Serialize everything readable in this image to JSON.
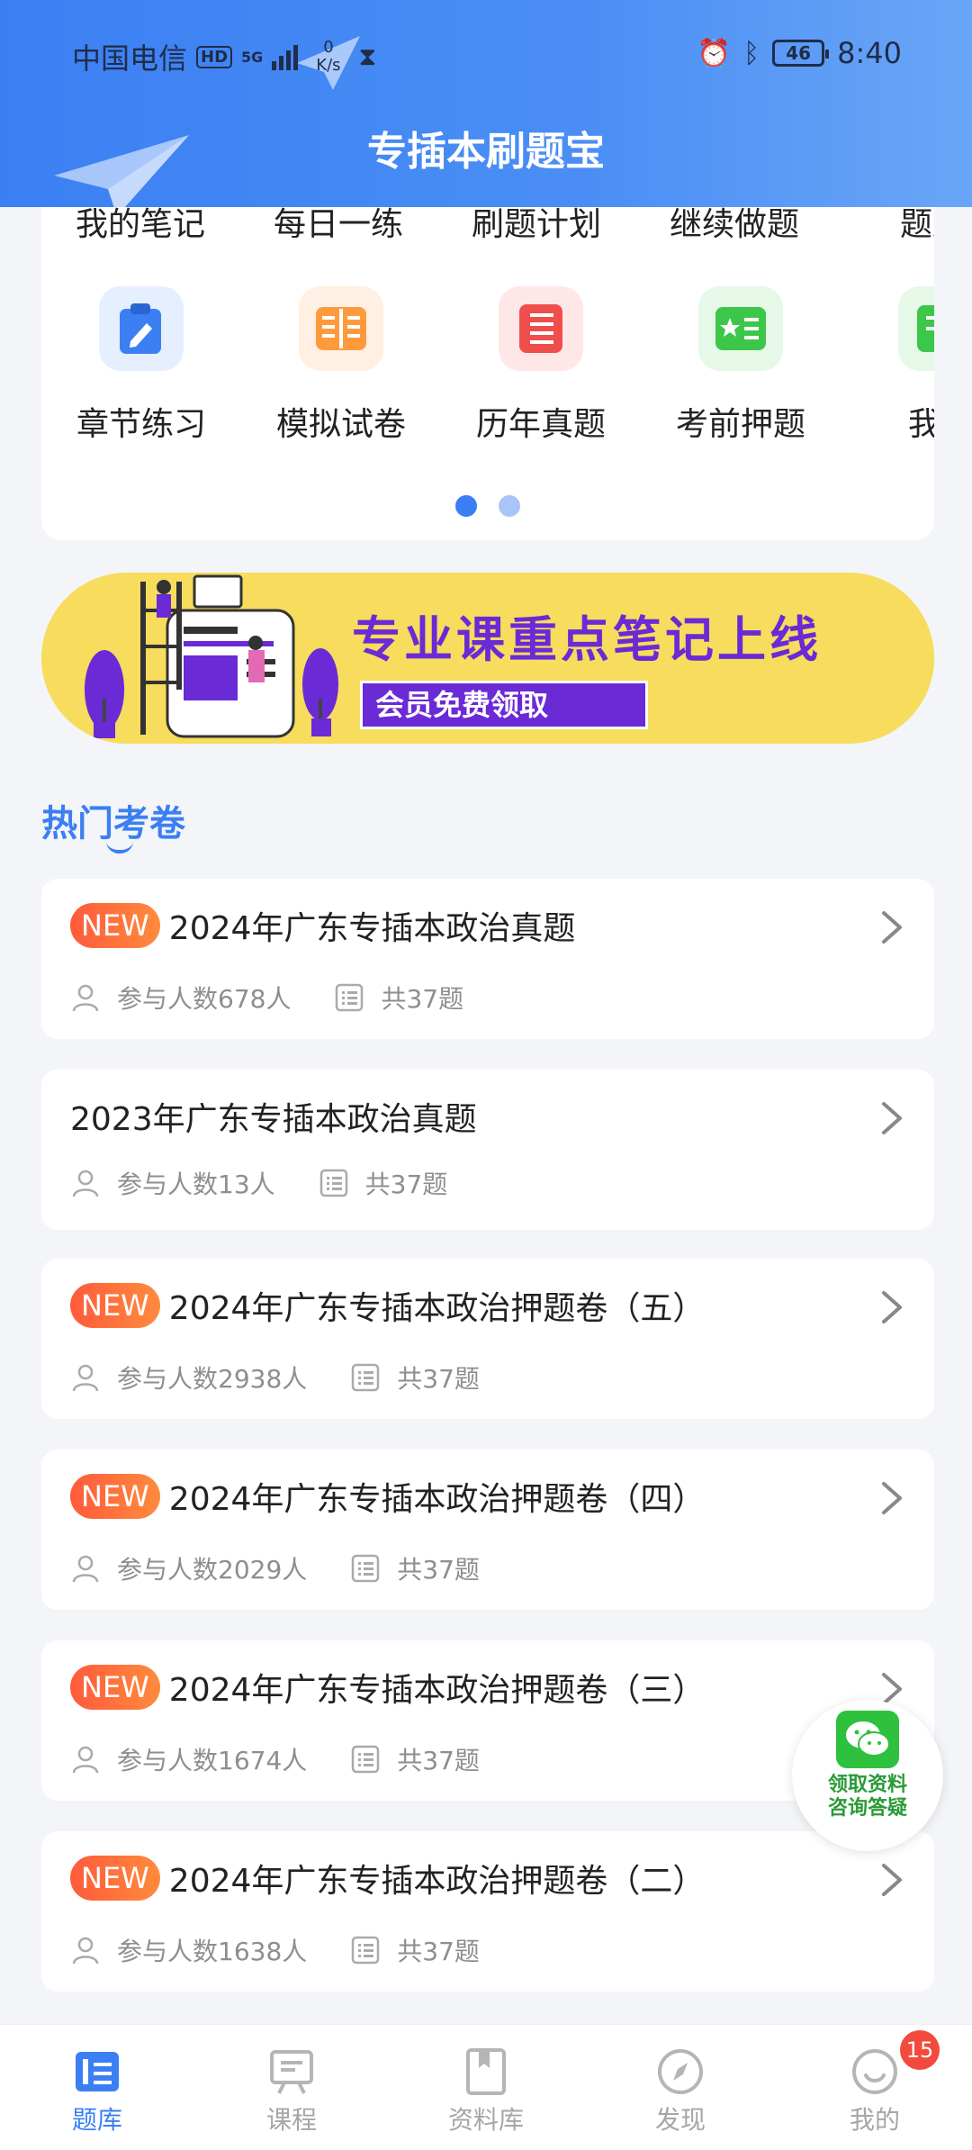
{
  "status_bar": {
    "carrier": "中国电信",
    "hd": "HD",
    "network": "5G",
    "speed_value": "0",
    "speed_unit": "K/s",
    "battery": "46",
    "time": "8:40"
  },
  "header": {
    "title": "专插本刷题宝"
  },
  "categories": {
    "cut_row": [
      "我的笔记",
      "每日一练",
      "刷题计划",
      "继续做题",
      "题型"
    ],
    "items": [
      {
        "label": "章节练习",
        "icon": "pencil-clipboard-icon",
        "color": "#3b7ff3",
        "bg": "#e6efff"
      },
      {
        "label": "模拟试卷",
        "icon": "open-book-icon",
        "color": "#ff9a3c",
        "bg": "#fff0e3"
      },
      {
        "label": "历年真题",
        "icon": "list-document-icon",
        "color": "#f04d4d",
        "bg": "#ffe7e7"
      },
      {
        "label": "考前押题",
        "icon": "star-book-icon",
        "color": "#3cc74a",
        "bg": "#e6f8e8"
      },
      {
        "label": "我的",
        "icon": "my-collection-icon",
        "color": "#3cc74a",
        "bg": "#e6f8e8"
      }
    ],
    "page_count": 2,
    "active_page": 1
  },
  "banner": {
    "title": "专业课重点笔记上线",
    "button": "会员免费领取"
  },
  "section": {
    "title": "热门考卷"
  },
  "new_badge_label": "NEW",
  "exams": [
    {
      "title": "2024年广东专插本政治真题",
      "is_new": true,
      "participants": "参与人数678人",
      "questions": "共37题"
    },
    {
      "title": "2023年广东专插本政治真题",
      "is_new": false,
      "participants": "参与人数13人",
      "questions": "共37题"
    },
    {
      "title": "2024年广东专插本政治押题卷（五）",
      "is_new": true,
      "participants": "参与人数2938人",
      "questions": "共37题"
    },
    {
      "title": "2024年广东专插本政治押题卷（四）",
      "is_new": true,
      "participants": "参与人数2029人",
      "questions": "共37题"
    },
    {
      "title": "2024年广东专插本政治押题卷（三）",
      "is_new": true,
      "participants": "参与人数1674人",
      "questions": "共37题"
    },
    {
      "title": "2024年广东专插本政治押题卷（二）",
      "is_new": true,
      "participants": "参与人数1638人",
      "questions": "共37题"
    }
  ],
  "float_service": {
    "line1": "领取资料",
    "line2": "咨询答疑",
    "icon": "wechat-icon"
  },
  "bottom_nav": [
    {
      "label": "题库",
      "icon": "question-bank-icon",
      "active": true
    },
    {
      "label": "课程",
      "icon": "course-icon",
      "active": false
    },
    {
      "label": "资料库",
      "icon": "material-library-icon",
      "active": false
    },
    {
      "label": "发现",
      "icon": "discover-compass-icon",
      "active": false
    },
    {
      "label": "我的",
      "icon": "profile-icon",
      "active": false,
      "badge": "15"
    }
  ],
  "colors": {
    "primary": "#3b7ff3",
    "new_badge": "#ff6a3c",
    "banner_bg": "#f7dc5d",
    "banner_accent": "#6a2ad6",
    "page_bg": "#f3f5f9"
  }
}
